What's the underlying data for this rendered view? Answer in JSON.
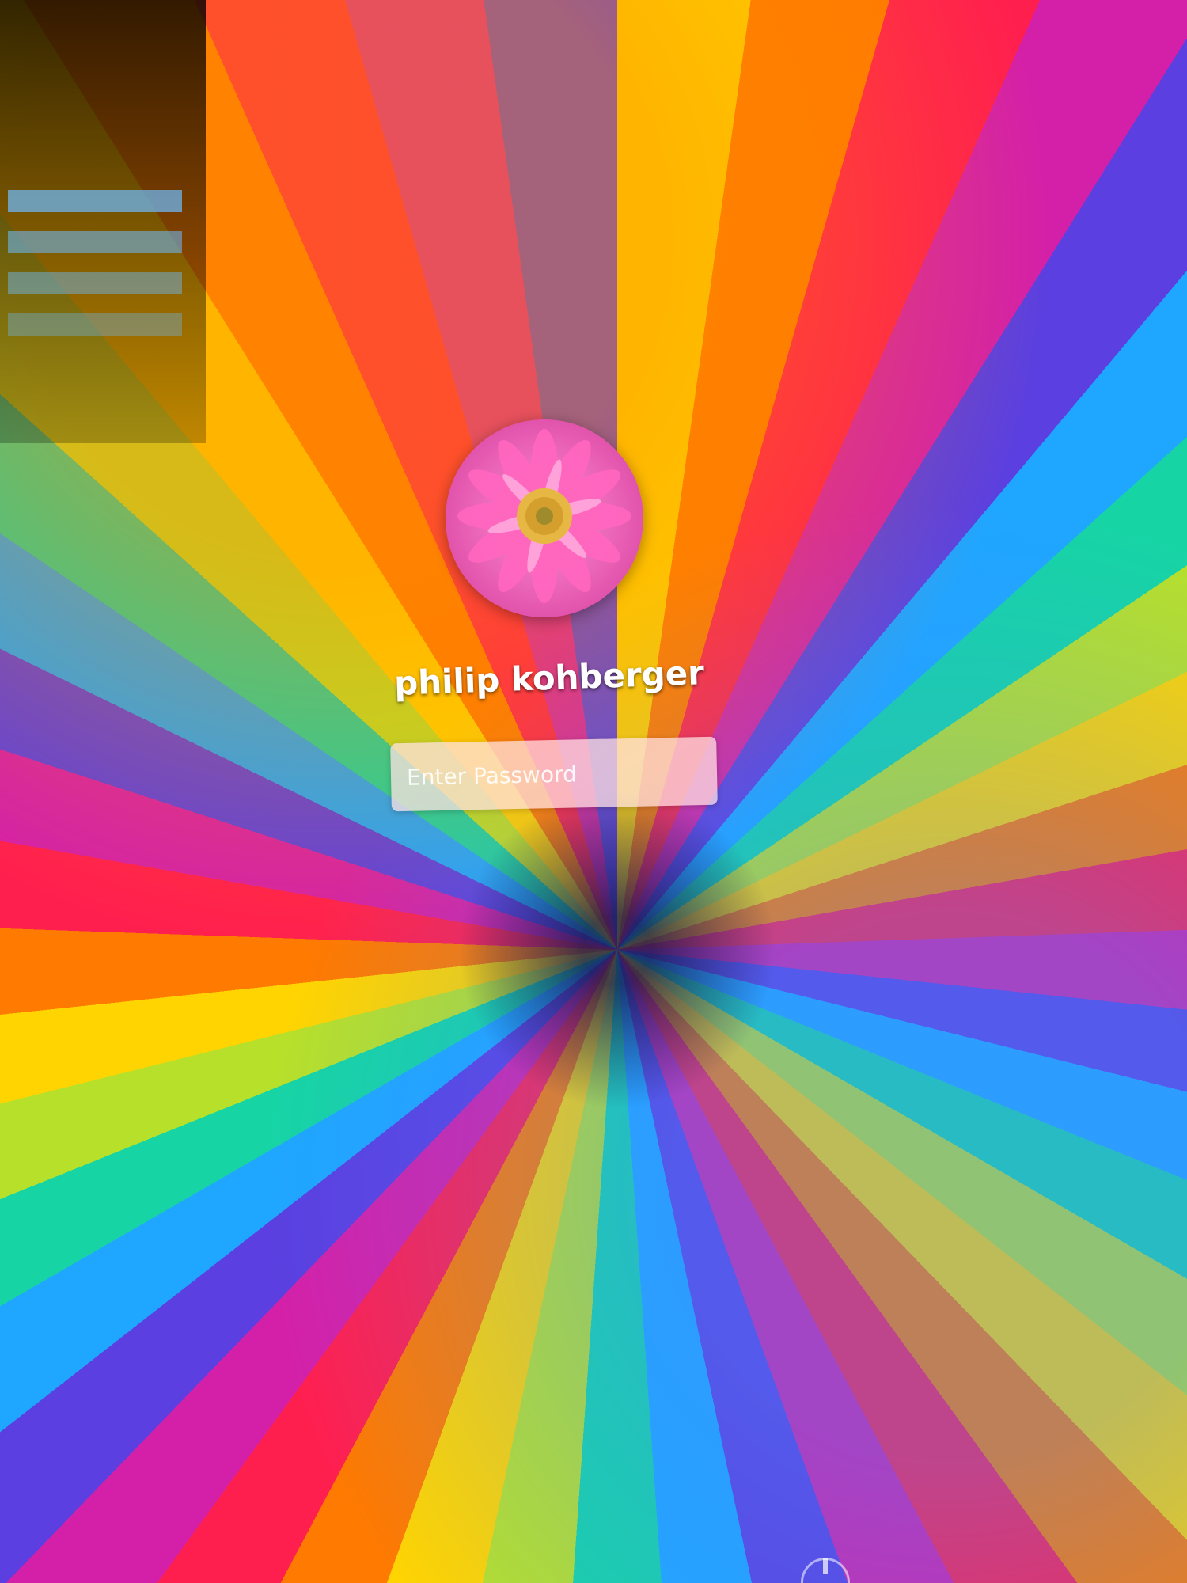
{
  "login": {
    "user_name": "philip kohberger",
    "password_placeholder": "Enter Password"
  },
  "avatar": {
    "semantic_name": "pink-flower-avatar"
  },
  "power": {
    "semantic_name": "power-icon"
  },
  "colors": {
    "text": "#ffffff",
    "field_bg": "#ffe1e1",
    "flower_pink": "#f05ab5",
    "flower_center": "#e3c64f"
  }
}
